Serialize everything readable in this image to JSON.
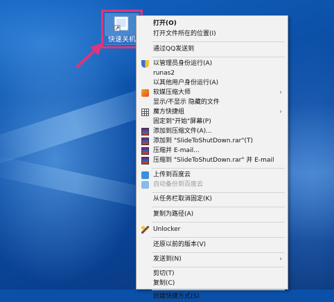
{
  "desktop": {
    "shortcut_label": "快速关机",
    "shortcut_icon": "shortcut-file-icon",
    "highlight_color": "#e0357a"
  },
  "context_menu": {
    "items": [
      {
        "label": "打开(O)",
        "bold": true
      },
      {
        "label": "打开文件所在的位置(I)"
      },
      {
        "label": "通过QQ发送到"
      },
      {
        "label": "以管理员身份运行(A)",
        "icon": "uac-shield-icon"
      },
      {
        "label": "runas2"
      },
      {
        "label": "以其他用户身份运行(A)"
      },
      {
        "label": "软媒压缩大师",
        "icon": "compress-master-icon",
        "submenu": true
      },
      {
        "label": "显示/不显示 隐藏的文件"
      },
      {
        "label": "魔方快捷组",
        "icon": "grid-icon",
        "submenu": true
      },
      {
        "label": "固定到\"开始\"屏幕(P)"
      },
      {
        "label": "添加到压缩文件(A)...",
        "icon": "winrar-icon"
      },
      {
        "label": "添加到 \"SlideToShutDown.rar\"(T)",
        "icon": "winrar-icon"
      },
      {
        "label": "压缩并 E-mail...",
        "icon": "winrar-icon"
      },
      {
        "label": "压缩到 \"SlideToShutDown.rar\" 并 E-mail",
        "icon": "winrar-icon"
      },
      {
        "label": "上传到百度云",
        "icon": "baidu-cloud-icon"
      },
      {
        "label": "自动备份到百度云",
        "icon": "baidu-cloud-icon",
        "disabled": true
      },
      {
        "label": "从任务栏取消固定(K)"
      },
      {
        "label": "复制为路径(A)"
      },
      {
        "label": "Unlocker",
        "icon": "unlocker-wand-icon"
      },
      {
        "label": "还原以前的版本(V)"
      },
      {
        "label": "发送到(N)",
        "submenu": true
      },
      {
        "label": "剪切(T)"
      },
      {
        "label": "复制(C)"
      },
      {
        "label": "创建快捷方式(S)"
      }
    ],
    "submenu_glyph": "›"
  }
}
